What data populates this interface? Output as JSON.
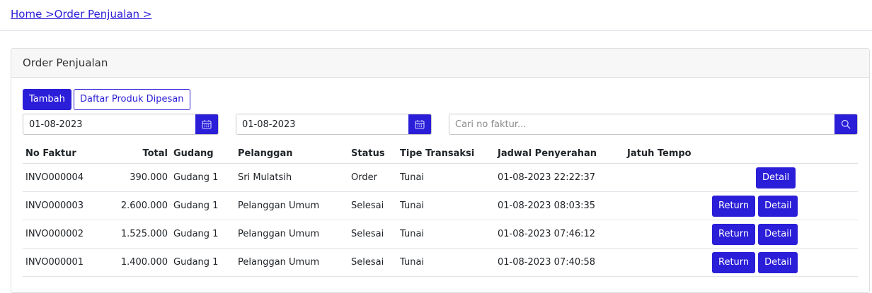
{
  "breadcrumb": {
    "home": "Home >",
    "order": "Order Penjualan >"
  },
  "card": {
    "title": "Order Penjualan"
  },
  "toolbar": {
    "add_label": "Tambah",
    "ordered_products_label": "Daftar Produk Dipesan"
  },
  "filters": {
    "date_from": "01-08-2023",
    "date_to": "01-08-2023",
    "search_placeholder": "Cari no faktur..."
  },
  "table": {
    "headers": {
      "no_faktur": "No Faktur",
      "total": "Total",
      "gudang": "Gudang",
      "pelanggan": "Pelanggan",
      "status": "Status",
      "tipe": "Tipe Transaksi",
      "jadwal": "Jadwal Penyerahan",
      "jatuh_tempo": "Jatuh Tempo"
    },
    "rows": [
      {
        "no_faktur": "INVO000004",
        "total": "390.000",
        "gudang": "Gudang 1",
        "pelanggan": "Sri Mulatsih",
        "status": "Order",
        "tipe": "Tunai",
        "jadwal": "01-08-2023 22:22:37",
        "jatuh_tempo": "",
        "detail": "Detail"
      },
      {
        "no_faktur": "INVO000003",
        "total": "2.600.000",
        "gudang": "Gudang 1",
        "pelanggan": "Pelanggan Umum",
        "status": "Selesai",
        "tipe": "Tunai",
        "jadwal": "01-08-2023 08:03:35",
        "jatuh_tempo": "",
        "return": "Return",
        "detail": "Detail"
      },
      {
        "no_faktur": "INVO000002",
        "total": "1.525.000",
        "gudang": "Gudang 1",
        "pelanggan": "Pelanggan Umum",
        "status": "Selesai",
        "tipe": "Tunai",
        "jadwal": "01-08-2023 07:46:12",
        "jatuh_tempo": "",
        "return": "Return",
        "detail": "Detail"
      },
      {
        "no_faktur": "INVO000001",
        "total": "1.400.000",
        "gudang": "Gudang 1",
        "pelanggan": "Pelanggan Umum",
        "status": "Selesai",
        "tipe": "Tunai",
        "jadwal": "01-08-2023 07:40:58",
        "jatuh_tempo": "",
        "return": "Return",
        "detail": "Detail"
      }
    ]
  },
  "icons": {
    "date_from": "calendar-icon",
    "date_to": "calendar-icon",
    "search": "search-icon"
  },
  "colors": {
    "primary": "#2b1ed8",
    "link": "#2b1ed8"
  }
}
